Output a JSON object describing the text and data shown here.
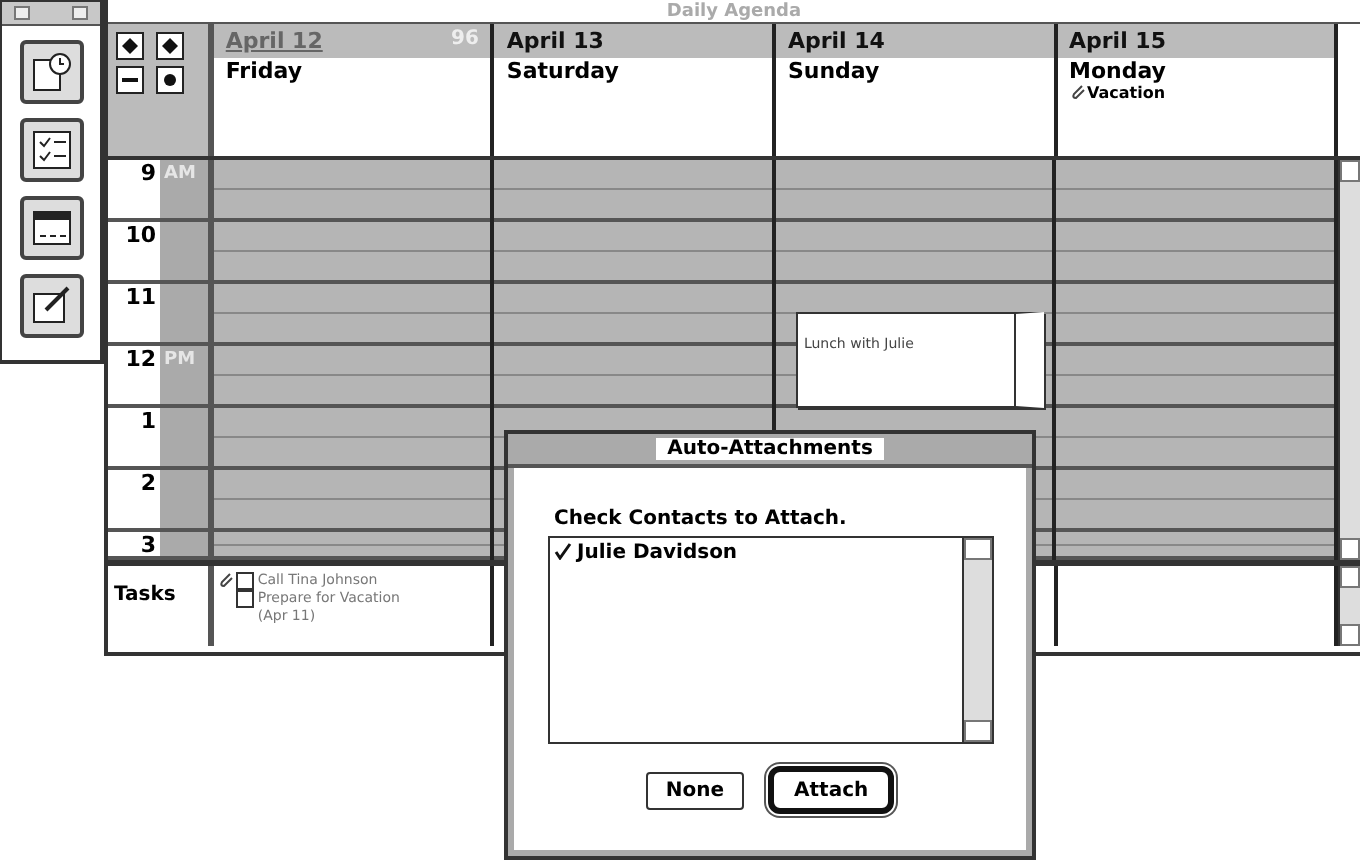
{
  "window": {
    "title": "Daily Agenda"
  },
  "days": [
    {
      "date": "April 12",
      "weekday": "Friday",
      "day_number": "96",
      "selected": true
    },
    {
      "date": "April 13",
      "weekday": "Saturday",
      "selected": false
    },
    {
      "date": "April 14",
      "weekday": "Sunday",
      "selected": false,
      "events": [
        {
          "title": "Lunch with Julie"
        }
      ]
    },
    {
      "date": "April 15",
      "weekday": "Monday",
      "selected": false,
      "note": "Vacation"
    }
  ],
  "hours": [
    {
      "label": "9",
      "period": "AM"
    },
    {
      "label": "10"
    },
    {
      "label": "11"
    },
    {
      "label": "12",
      "period": "PM"
    },
    {
      "label": "1"
    },
    {
      "label": "2"
    },
    {
      "label": "3"
    }
  ],
  "tasks": {
    "label": "Tasks",
    "items": [
      {
        "text": "Call Tina Johnson",
        "checked": false
      },
      {
        "text": "Prepare for Vacation (Apr 11)",
        "checked": false
      }
    ]
  },
  "dialog": {
    "title": "Auto-Attachments",
    "prompt": "Check Contacts to Attach.",
    "contacts": [
      {
        "name": "Julie Davidson",
        "checked": true
      }
    ],
    "buttons": [
      {
        "label": "None",
        "default": false
      },
      {
        "label": "Attach",
        "default": true
      }
    ]
  }
}
